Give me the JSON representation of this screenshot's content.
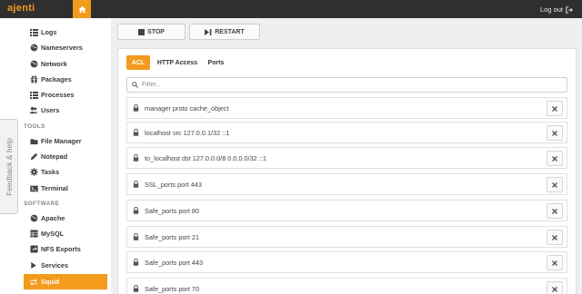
{
  "app": {
    "brand": "ajenti",
    "logout_label": "Log out"
  },
  "colors": {
    "accent": "#f29b1c",
    "topbar": "#2f2f2f"
  },
  "sidebar": {
    "items": [
      {
        "label": "Logs",
        "icon": "list-icon"
      },
      {
        "label": "Nameservers",
        "icon": "globe-icon"
      },
      {
        "label": "Network",
        "icon": "globe-icon"
      },
      {
        "label": "Packages",
        "icon": "gift-icon"
      },
      {
        "label": "Processes",
        "icon": "list-icon"
      },
      {
        "label": "Users",
        "icon": "users-icon"
      }
    ],
    "tools_title": "TOOLS",
    "tools": [
      {
        "label": "File Manager",
        "icon": "folder-icon"
      },
      {
        "label": "Notepad",
        "icon": "pencil-icon"
      },
      {
        "label": "Tasks",
        "icon": "gear-icon"
      },
      {
        "label": "Terminal",
        "icon": "terminal-icon"
      }
    ],
    "software_title": "SOFTWARE",
    "software": [
      {
        "label": "Apache",
        "icon": "globe-icon"
      },
      {
        "label": "MySQL",
        "icon": "database-icon"
      },
      {
        "label": "NFS Exports",
        "icon": "share-icon"
      },
      {
        "label": "Services",
        "icon": "play-icon"
      },
      {
        "label": "Squid",
        "icon": "exchange-icon",
        "active": true
      }
    ]
  },
  "feedback_label": "Feedback & help",
  "toolbar": {
    "stop_label": "STOP",
    "restart_label": "RESTART"
  },
  "tabs": [
    {
      "label": "ACL",
      "active": true
    },
    {
      "label": "HTTP Access",
      "active": false
    },
    {
      "label": "Ports",
      "active": false
    }
  ],
  "filter": {
    "placeholder": "Filter..."
  },
  "acl_rows": [
    "manager proto cache_object",
    "localhost src 127.0.0.1/32 ::1",
    "to_localhost dst 127.0.0.0/8 0.0.0.0/32 ::1",
    "SSL_ports port 443",
    "Safe_ports port 80",
    "Safe_ports port 21",
    "Safe_ports port 443",
    "Safe_ports port 70"
  ]
}
